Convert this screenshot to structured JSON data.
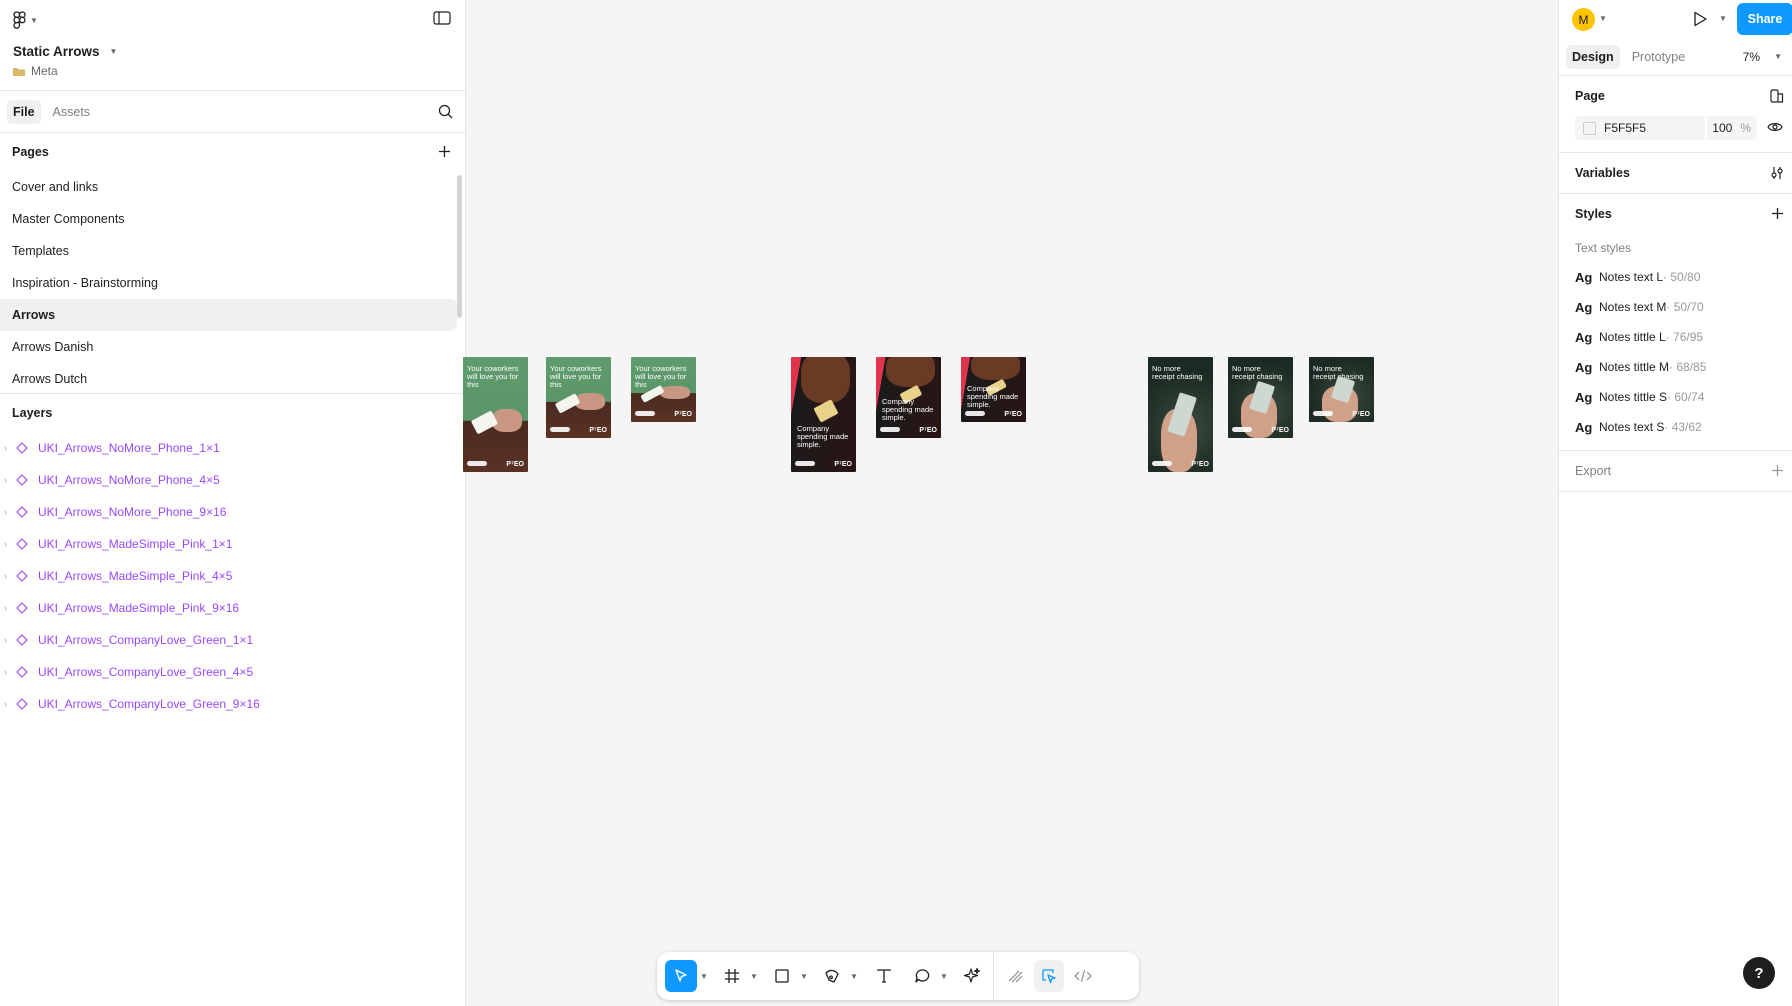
{
  "file": {
    "title": "Static Arrows",
    "team": "Meta"
  },
  "left_tabs": [
    "File",
    "Assets"
  ],
  "pages": {
    "heading": "Pages",
    "items": [
      "Cover and links",
      "Master Components",
      "Templates",
      "Inspiration - Brainstorming",
      "Arrows",
      "Arrows  Danish",
      "Arrows  Dutch"
    ],
    "active_index": 4
  },
  "layers": {
    "heading": "Layers",
    "items": [
      "UKI_Arrows_NoMore_Phone_1×1",
      "UKI_Arrows_NoMore_Phone_4×5",
      "UKI_Arrows_NoMore_Phone_9×16",
      "UKI_Arrows_MadeSimple_Pink_1×1",
      "UKI_Arrows_MadeSimple_Pink_4×5",
      "UKI_Arrows_MadeSimple_Pink_9×16",
      "UKI_Arrows_CompanyLove_Green_1×1",
      "UKI_Arrows_CompanyLove_Green_4×5",
      "UKI_Arrows_CompanyLove_Green_9×16"
    ]
  },
  "canvas": {
    "frames": [
      {
        "theme": "green",
        "text": "Your coworkers will love you for this"
      },
      {
        "theme": "green",
        "text": "Your coworkers will love you for this"
      },
      {
        "theme": "green",
        "text": "Your coworkers will love you for this"
      },
      {
        "theme": "pink",
        "text": "Company spending made simple."
      },
      {
        "theme": "pink",
        "text": "Company spending made simple."
      },
      {
        "theme": "pink",
        "text": "Company spending made simple."
      },
      {
        "theme": "dark",
        "text": "No more receipt chasing"
      },
      {
        "theme": "dark",
        "text": "No more receipt chasing"
      },
      {
        "theme": "dark",
        "text": "No more receipt chasing"
      }
    ],
    "brand_mark": "P⁷EO",
    "background": "#F5F5F5"
  },
  "right": {
    "avatar_initial": "M",
    "share_label": "Share",
    "tabs": [
      "Design",
      "Prototype"
    ],
    "zoom": "7%",
    "page": {
      "heading": "Page",
      "color": "F5F5F5",
      "opacity": "100",
      "unit": "%"
    },
    "variables_heading": "Variables",
    "styles_heading": "Styles",
    "text_styles_heading": "Text styles",
    "text_styles": [
      {
        "name": "Notes text L",
        "meta": " · 50/80"
      },
      {
        "name": "Notes text M",
        "meta": " · 50/70"
      },
      {
        "name": "Notes tittle L",
        "meta": " · 76/95"
      },
      {
        "name": "Notes tittle M",
        "meta": " · 68/85"
      },
      {
        "name": "Notes tittle S",
        "meta": " · 60/74"
      },
      {
        "name": "Notes text S",
        "meta": " · 43/62"
      }
    ],
    "text_style_glyph": "Ag",
    "export_heading": "Export"
  },
  "help_label": "?",
  "colors": {
    "accent": "#0d99ff",
    "component": "#9747ff",
    "avatar": "#ffc400"
  }
}
